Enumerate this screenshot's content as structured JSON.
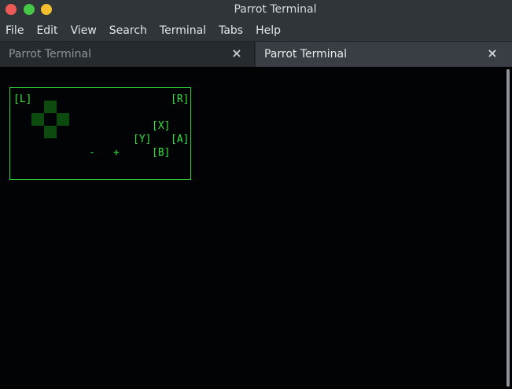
{
  "window": {
    "title": "Parrot Terminal"
  },
  "menubar": {
    "items": [
      "File",
      "Edit",
      "View",
      "Search",
      "Terminal",
      "Tabs",
      "Help"
    ]
  },
  "tabs": [
    {
      "label": "Parrot Terminal",
      "active": false,
      "close": "×"
    },
    {
      "label": "Parrot Terminal",
      "active": true,
      "close": "×"
    }
  ],
  "gamepad": {
    "left_shoulder": "[L]",
    "right_shoulder": "[R]",
    "button_x": "[X]",
    "button_y": "[Y]",
    "button_a": "[A]",
    "button_b": "[B]",
    "minus": "-",
    "plus": "+"
  },
  "colors": {
    "terminal_bg": "#020305",
    "text_green": "#35e23d",
    "dpad_fill": "#0c4a10",
    "titlebar_bg": "#2f3539",
    "traffic_close": "#ed5a55",
    "traffic_max": "#45c848",
    "traffic_min": "#f3bf2f"
  }
}
